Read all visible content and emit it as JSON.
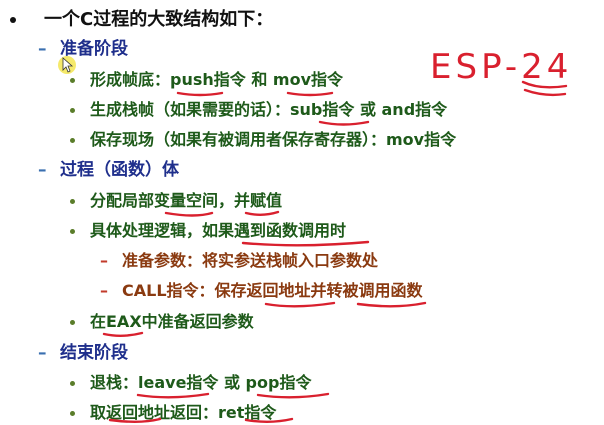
{
  "outline": {
    "heading": "一个C过程的大致结构如下：",
    "sections": [
      {
        "title": "准备阶段",
        "items": [
          "形成帧底：push指令 和 mov指令",
          "生成栈帧（如果需要的话）：sub指令 或 and指令",
          "保存现场（如果有被调用者保存寄存器）：mov指令"
        ]
      },
      {
        "title": "过程（函数）体",
        "items": [
          "分配局部变量空间，并赋值",
          "具体处理逻辑，如果遇到函数调用时"
        ],
        "subitems": [
          "准备参数：将实参送栈帧入口参数处",
          "CALL指令：保存返回地址并转被调用函数"
        ],
        "after_subitems": [
          "在EAX中准备返回参数"
        ]
      },
      {
        "title": "结束阶段",
        "items": [
          "退栈：leave指令 或 pop指令",
          "取返回地址返回：ret指令"
        ]
      }
    ]
  },
  "handwritten_note": "ESP-24",
  "colors": {
    "annotation_red": "#d9202e",
    "heading_black": "#111111",
    "section_blue": "#1f2f8c",
    "item_green": "#1e5a1a",
    "subitem_brown": "#8a3a10",
    "cursor_yellow": "#f2e23a"
  },
  "icons": {
    "cursor": "pointer-cursor-highlight"
  }
}
